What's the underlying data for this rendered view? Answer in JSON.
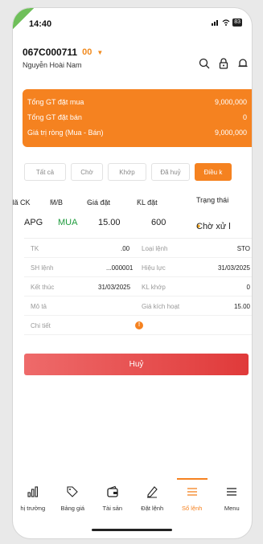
{
  "status_bar": {
    "time": "14:40",
    "battery": "83"
  },
  "account": {
    "number": "067C000711",
    "sub": "00",
    "name": "Nguyễn Hoài Nam"
  },
  "summary": [
    {
      "label": "Tổng GT đặt mua",
      "value": "9,000,000"
    },
    {
      "label": "Tổng GT đặt bán",
      "value": "0"
    },
    {
      "label": "Giá trị ròng (Mua - Bán)",
      "value": "9,000,000"
    }
  ],
  "tabs": [
    "Tất cả",
    "Chờ",
    "Khớp",
    "Đã huỷ",
    "Điều k"
  ],
  "table_header": {
    "ck": "Mã CK",
    "mb": "M/B",
    "price": "Giá đặt",
    "qty": "KL đặt",
    "status": "Trạng thái"
  },
  "order": {
    "symbol": "APG",
    "side": "MUA",
    "price": "15.00",
    "qty": "600",
    "status": "Chờ xử l"
  },
  "detail": {
    "tk_label": "TK",
    "tk_value": ".00",
    "order_type_label": "Loại lệnh",
    "order_type_value": "STO",
    "sh_label": "SH lệnh",
    "sh_value": "...000001",
    "valid_label": "Hiệu lực",
    "valid_value": "31/03/2025",
    "end_label": "Kết thúc",
    "end_value": "31/03/2025",
    "matched_label": "KL khớp",
    "matched_value": "0",
    "desc_label": "Mô tả",
    "trigger_label": "Giá kích hoạt",
    "trigger_value": "15.00",
    "more_label": "Chi tiết"
  },
  "cancel_label": "Huỷ",
  "nav": [
    {
      "label": "hị trường",
      "icon": "market-chart-icon"
    },
    {
      "label": "Bảng giá",
      "icon": "price-tag-icon"
    },
    {
      "label": "Tài sản",
      "icon": "wallet-icon"
    },
    {
      "label": "Đặt lệnh",
      "icon": "order-pen-icon"
    },
    {
      "label": "Sổ lệnh",
      "icon": "order-book-icon",
      "active": true
    },
    {
      "label": "Menu",
      "icon": "menu-icon"
    }
  ],
  "colors": {
    "accent": "#f58220",
    "buy": "#1e9b3c",
    "cancel": "#e03a3a"
  }
}
